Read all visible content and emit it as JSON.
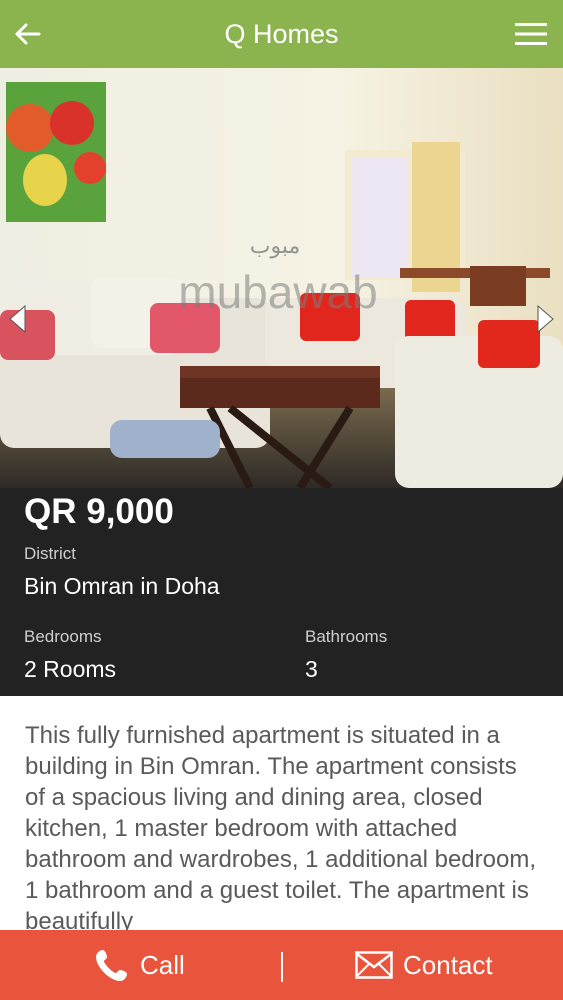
{
  "app": {
    "title": "Q Homes"
  },
  "icons": {
    "back": "back-arrow-icon",
    "menu": "hamburger-menu-icon",
    "prev": "chevron-left-icon",
    "next": "chevron-right-icon",
    "call": "phone-icon",
    "contact": "envelope-icon"
  },
  "gallery": {
    "watermark_arabic": "مبوب",
    "watermark_latin": "mubawab"
  },
  "listing": {
    "price": "QR 9,000",
    "district_label": "District",
    "district_value": "Bin Omran in Doha",
    "bedrooms_label": "Bedrooms",
    "bedrooms_value": "2 Rooms",
    "bathrooms_label": "Bathrooms",
    "bathrooms_value": "3",
    "description": "This fully furnished apartment is situated in a building in Bin Omran. The apartment consists of a spacious living and dining area, closed kitchen, 1 master bedroom with attached bathroom and wardrobes, 1 additional bedroom, 1 bathroom and a guest toilet. The apartment is beautifully"
  },
  "actions": {
    "call_label": "Call",
    "contact_label": "Contact"
  },
  "colors": {
    "appbar": "#8bb44e",
    "info_panel": "#222222",
    "action_bar": "#e8553c"
  }
}
